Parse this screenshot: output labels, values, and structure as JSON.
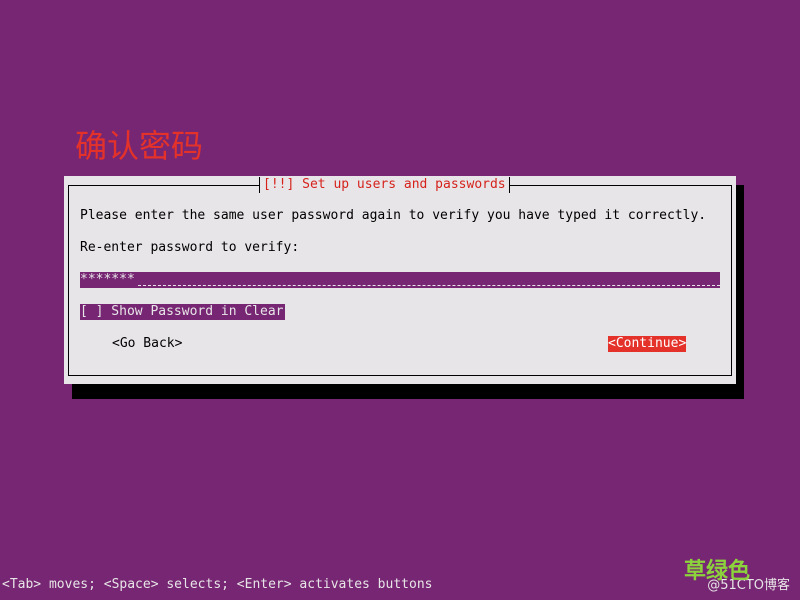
{
  "annotation": {
    "text": "确认密码"
  },
  "dialog": {
    "title": "[!!] Set up users and passwords",
    "instruction": "Please enter the same user password again to verify you have typed it correctly.",
    "prompt_label": "Re-enter password to verify:",
    "password_field": {
      "value": "*******"
    },
    "show_password_checkbox": {
      "label": "[ ] Show Password in Clear",
      "checked": false
    },
    "buttons": {
      "go_back": "<Go Back>",
      "continue": "<Continue>"
    }
  },
  "footer": {
    "hint": "<Tab> moves; <Space> selects; <Enter> activates buttons"
  },
  "watermark": {
    "main": "草绿色",
    "sub": "@51CTO博客"
  },
  "colors": {
    "background": "#762672",
    "dialog_bg": "#e8e5e8",
    "accent_red": "#e4322b",
    "title_red": "#d5221c",
    "watermark_green": "#8cd23c"
  }
}
